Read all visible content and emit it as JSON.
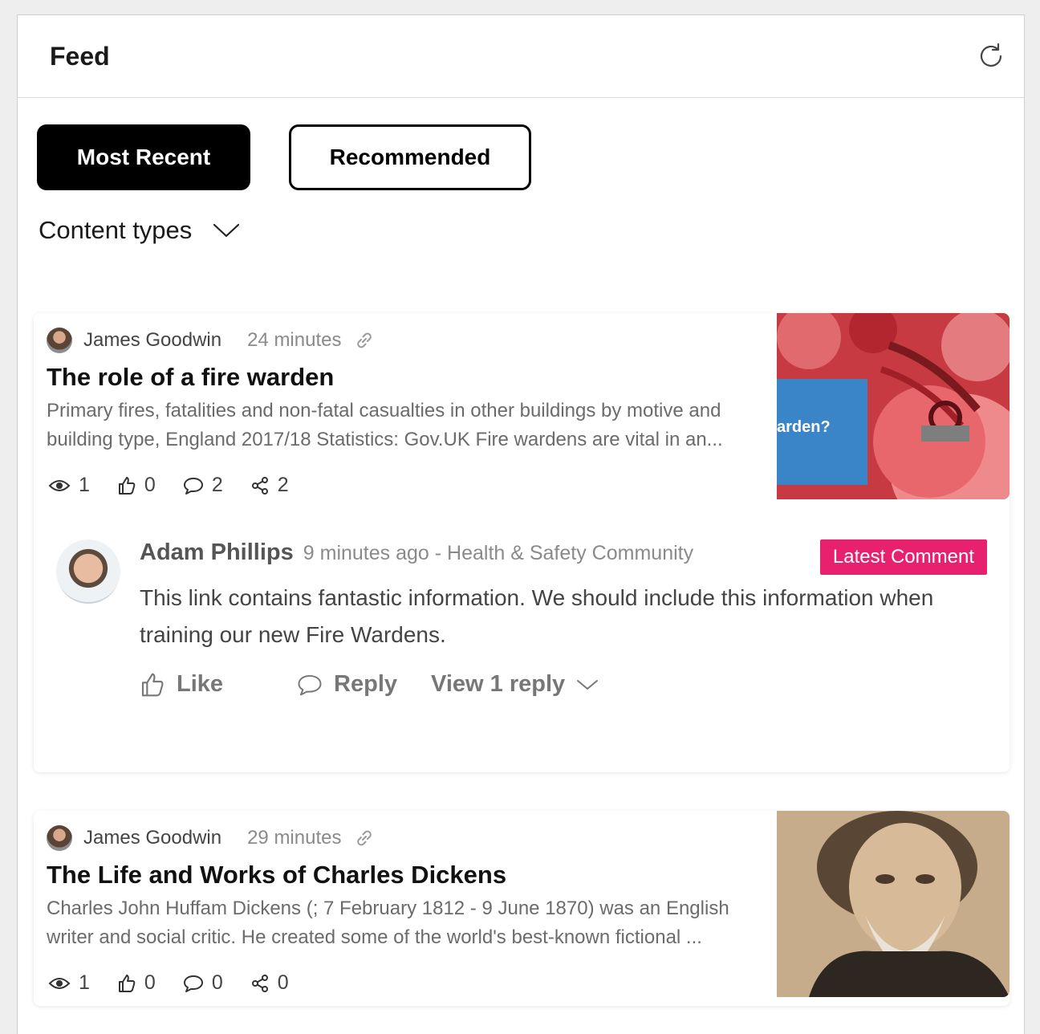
{
  "header": {
    "title": "Feed",
    "refresh_icon": "refresh-icon"
  },
  "tabs": {
    "most_recent": "Most Recent",
    "recommended": "Recommended"
  },
  "filter": {
    "label": "Content types"
  },
  "posts": [
    {
      "author": "James Goodwin",
      "time": "24 minutes",
      "title": "The role of a fire warden",
      "excerpt": "Primary fires, fatalities and non-fatal casualties in other buildings by motive and building type, England 2017/18 Statistics: Gov.UK Fire wardens are vital in an...",
      "views": "1",
      "likes": "0",
      "comments": "2",
      "shares": "2",
      "image_text": "arden?"
    },
    {
      "author": "James Goodwin",
      "time": "29 minutes",
      "title": "The Life and Works of Charles Dickens",
      "excerpt": "Charles John Huffam Dickens (; 7 February 1812 - 9 June 1870) was an English writer and social critic. He created some of the world's best-known fictional ...",
      "views": "1",
      "likes": "0",
      "comments": "0",
      "shares": "0"
    }
  ],
  "comment": {
    "author": "Adam Phillips",
    "meta": "9 minutes ago - Health & Safety Community",
    "badge": "Latest Comment",
    "text": "This link contains fantastic information. We should include this information when training our new Fire Wardens.",
    "like_label": "Like",
    "reply_label": "Reply",
    "view_replies_label": "View 1 reply"
  },
  "colors": {
    "accent": "#e8216f",
    "tab_active_bg": "#000000"
  }
}
